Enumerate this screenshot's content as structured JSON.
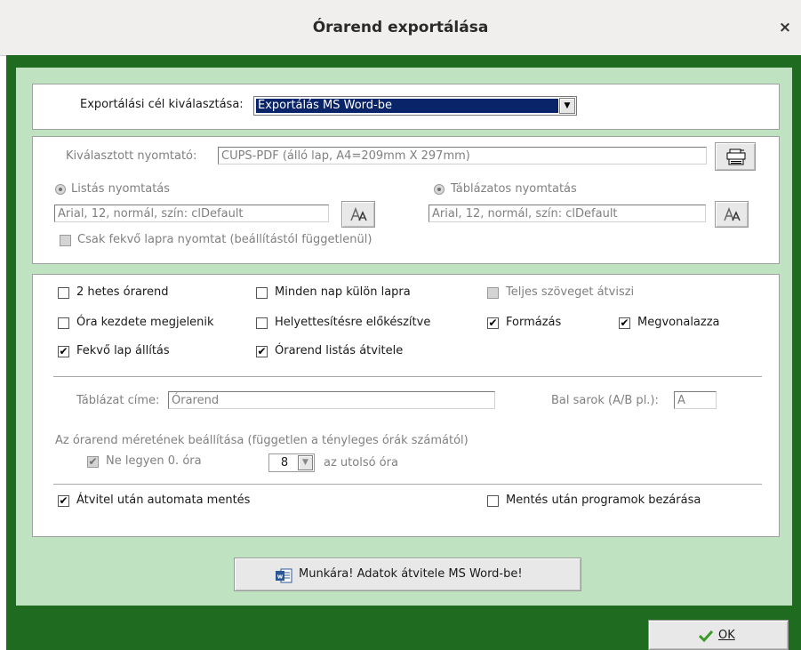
{
  "window": {
    "title": "Órarend exportálása",
    "close_glyph": "×"
  },
  "export_target": {
    "label": "Exportálási cél kiválasztása:",
    "selected": "Exportálás MS Word-be"
  },
  "printer": {
    "label": "Kiválasztott nyomtató:",
    "value": "CUPS-PDF (álló lap, A4=209mm X 297mm)",
    "list_radio_label": "Listás nyomtatás",
    "list_font": "Arial, 12, normál, szín: clDefault",
    "table_radio_label": "Táblázatos nyomtatás",
    "table_font": "Arial, 12, normál, szín: clDefault",
    "landscape_only_label": "Csak fekvő lapra nyomtat (beállítástól függetlenül)"
  },
  "options": {
    "two_week": {
      "label": "2 hetes órarend",
      "checked": false
    },
    "each_day_page": {
      "label": "Minden nap külön lapra",
      "checked": false
    },
    "full_text": {
      "label": "Teljes szöveget átviszi",
      "checked": false
    },
    "start_time": {
      "label": "Óra kezdete megjelenik",
      "checked": false
    },
    "substitution": {
      "label": "Helyettesítésre előkészítve",
      "checked": false
    },
    "formatting": {
      "label": "Formázás",
      "checked": true
    },
    "underline": {
      "label": "Megvonalazza",
      "checked": true
    },
    "landscape": {
      "label": "Fekvő lap állítás",
      "checked": true
    },
    "list_transfer": {
      "label": "Órarend listás átvitele",
      "checked": true
    }
  },
  "table_title": {
    "label": "Táblázat címe:",
    "value": "Órarend"
  },
  "left_corner": {
    "label": "Bal sarok (A/B pl.):",
    "value": "A"
  },
  "size": {
    "heading": "Az órarend méretének beállítása (független a tényleges órák számától)",
    "no_zero": {
      "label": "Ne legyen 0. óra",
      "checked": true
    },
    "last_hour_value": "8",
    "last_hour_label": "az utolsó óra"
  },
  "auto_save": {
    "label": "Átvitel után automata mentés",
    "checked": true
  },
  "close_after_save": {
    "label": "Mentés után programok bezárása",
    "checked": false
  },
  "run_button": {
    "label": "Munkára! Adatok átvitele MS Word-be!",
    "icon": "word-icon"
  },
  "ok_button": {
    "label": "OK",
    "icon": "checkmark-icon"
  },
  "colors": {
    "frame_green": "#1f6b1f",
    "panel_green": "#bfe3c1",
    "selection_blue": "#0a246a"
  }
}
